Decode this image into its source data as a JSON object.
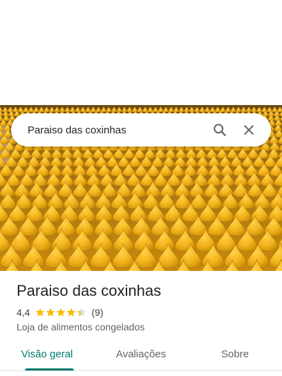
{
  "search": {
    "query": "Paraiso das coxinhas",
    "search_icon": "search-icon",
    "close_icon": "close-icon"
  },
  "hero": {
    "image_subject": "trays of golden fried coxinhas"
  },
  "place": {
    "name": "Paraiso das coxinhas",
    "rating": "4,4",
    "rating_value": 4.4,
    "review_count": "(9)",
    "category": "Loja de alimentos congelados"
  },
  "tabs": [
    {
      "label": "Visão geral",
      "active": true
    },
    {
      "label": "Avaliações",
      "active": false
    },
    {
      "label": "Sobre",
      "active": false
    }
  ],
  "colors": {
    "accent": "#00796b",
    "star": "#fbbc04",
    "coxinha": "#f2b61d"
  }
}
